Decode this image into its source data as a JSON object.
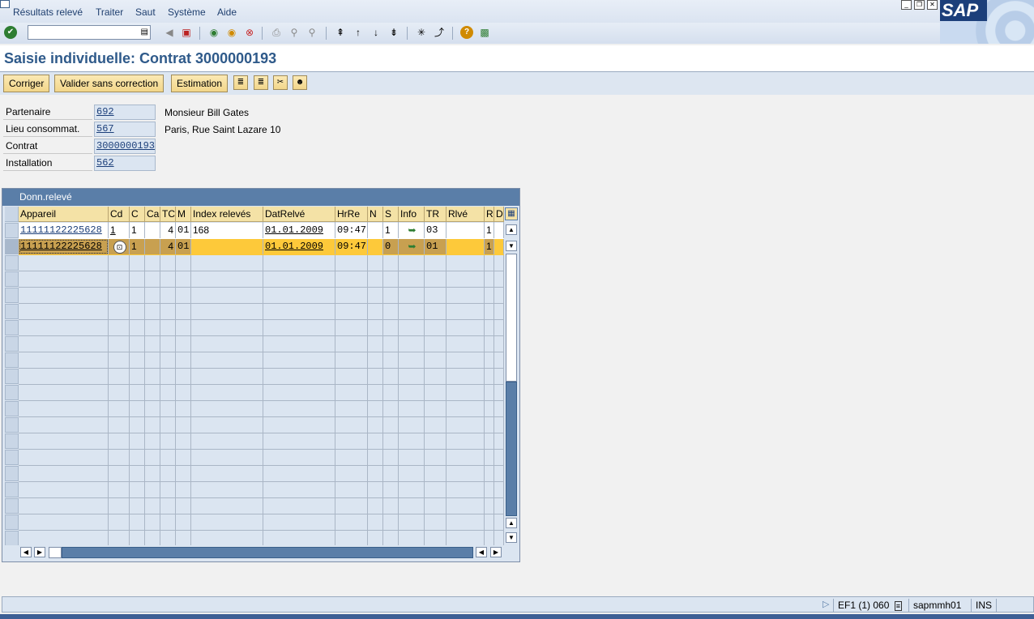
{
  "menu": {
    "items": [
      "Résultats relevé",
      "Traiter",
      "Saut",
      "Système",
      "Aide"
    ]
  },
  "brand": {
    "logo_text": "SAP"
  },
  "toolbar": {
    "command_value": ""
  },
  "title": "Saisie individuelle: Contrat 3000000193",
  "app_toolbar": {
    "corriger": "Corriger",
    "valider": "Valider sans correction",
    "estimation": "Estimation"
  },
  "header_fields": {
    "partenaire_label": "Partenaire",
    "partenaire_value": "692",
    "partenaire_text": "Monsieur Bill Gates",
    "lieu_label": "Lieu consommat.",
    "lieu_value": "567",
    "lieu_text": "Paris, Rue Saint Lazare  10",
    "contrat_label": "Contrat",
    "contrat_value": "3000000193",
    "installation_label": "Installation",
    "installation_value": "562"
  },
  "table": {
    "title": "Donn.relevé",
    "columns": [
      "Appareil",
      "Cd",
      "C",
      "Ca",
      "TC",
      "M",
      "Index relevés",
      "DatRelvé",
      "HrRe",
      "N",
      "S",
      "Info",
      "TR",
      "Rlvé",
      "R",
      "D"
    ],
    "rows": [
      {
        "appareil": "11111122225628",
        "cd": "1",
        "c": "1",
        "ca": "",
        "tc": "4",
        "m": "01",
        "index": "168",
        "date": "01.01.2009",
        "heure": "09:47",
        "n": "",
        "s": "1",
        "tr": "03",
        "rlve": "",
        "r": "1"
      },
      {
        "appareil": "11111122225628",
        "cd": "",
        "c": "1",
        "ca": "",
        "tc": "4",
        "m": "01",
        "index": "",
        "date": "01.01.2009",
        "heure": "09:47",
        "n": "",
        "s": "0",
        "tr": "01",
        "rlve": "",
        "r": "1"
      }
    ]
  },
  "statusbar": {
    "system": "EF1 (1) 060",
    "server": "sapmmh01",
    "mode": "INS"
  },
  "colors": {
    "accent": "#f0a030",
    "selected_row": "#fdc93a",
    "title_blue": "#2f5a8a"
  }
}
